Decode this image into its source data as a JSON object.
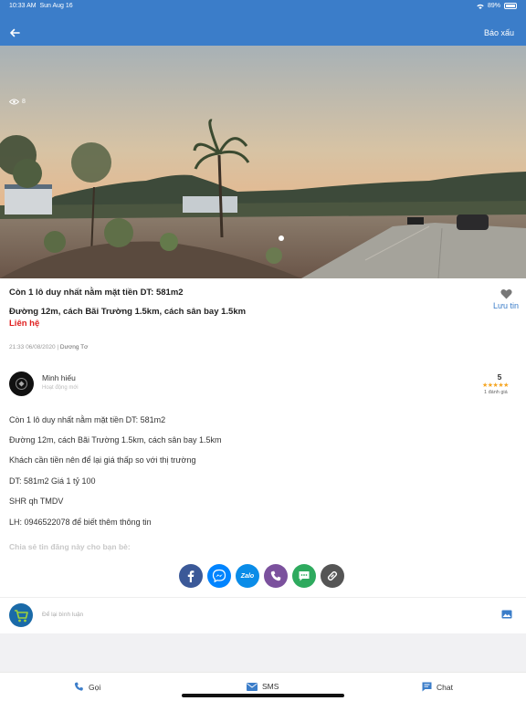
{
  "status_bar": {
    "time": "10:33 AM",
    "date": "Sun Aug 16",
    "battery": "89%"
  },
  "header": {
    "report_label": "Báo xấu"
  },
  "hero": {
    "view_count": "8"
  },
  "listing": {
    "title": "Còn 1 lô duy nhất nằm mặt tiền DT: 581m2",
    "subtitle": "Đường 12m, cách Bãi Trường 1.5km, cách sân bay 1.5km",
    "price": "Liên hệ",
    "save_label": "Lưu tin",
    "timestamp": "21:33 06/08/2020",
    "author": "Dương Tơ"
  },
  "seller": {
    "name": "Minh hiếu",
    "status": "Hoạt động mới",
    "rating": "5",
    "stars": "★★★★★",
    "rating_count": "1 đánh giá"
  },
  "description": [
    "Còn 1 lô duy nhất nằm mặt tiền DT: 581m2",
    "Đường 12m, cách Bãi Trường 1.5km, cách sân bay 1.5km",
    "Khách cần tiền nên để lại giá thấp so với thị trường",
    "DT: 581m2 Giá 1 tỷ 100",
    "SHR qh TMDV",
    "LH: 0946522078 để biết thêm thông tin"
  ],
  "share": {
    "label": "Chia sẻ tin đăng này cho bạn bè:",
    "zalo_text": "Zalo",
    "colors": {
      "facebook": "#3b5998",
      "messenger": "#0084ff",
      "zalo": "#0a8ce8",
      "viber": "#7b519d",
      "sms": "#2eaa5e",
      "link": "#555555"
    }
  },
  "comment": {
    "placeholder": "Để lại bình luận"
  },
  "bottom_bar": {
    "call": "Gọi",
    "sms": "SMS",
    "chat": "Chat"
  },
  "colors": {
    "brand_blue": "#3b7dc9",
    "price_red": "#e02020",
    "star": "#f5a623"
  }
}
